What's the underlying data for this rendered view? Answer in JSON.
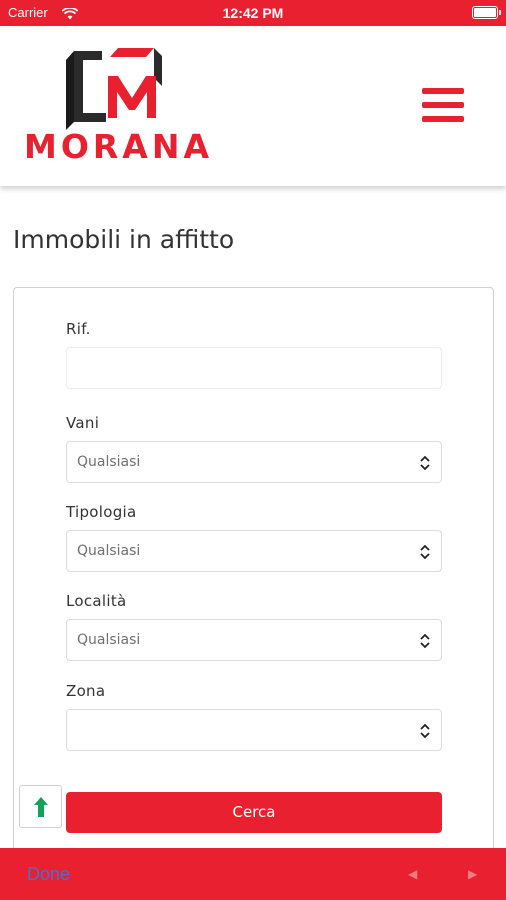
{
  "status_bar": {
    "carrier": "Carrier",
    "time": "12:42 PM"
  },
  "brand": {
    "name": "MORANA",
    "monogram": "CM",
    "colors": {
      "red": "#e8202f",
      "dark": "#2b2b2b"
    }
  },
  "page": {
    "title": "Immobili in affitto"
  },
  "form": {
    "rif": {
      "label": "Rif.",
      "value": "",
      "placeholder": ""
    },
    "vani": {
      "label": "Vani",
      "value": "Qualsiasi"
    },
    "tipologia": {
      "label": "Tipologia",
      "value": "Qualsiasi"
    },
    "localita": {
      "label": "Località",
      "value": "Qualsiasi"
    },
    "zona": {
      "label": "Zona",
      "value": ""
    },
    "submit_label": "Cerca"
  },
  "keyboard_toolbar": {
    "done_label": "Done",
    "prev_icon": "arrow-left-icon",
    "next_icon": "arrow-right-icon"
  },
  "icons": {
    "menu": "hamburger-menu-icon",
    "chevron": "up-down-chevron-icon",
    "scroll_top": "arrow-up-icon",
    "wifi": "wifi-icon",
    "battery": "battery-icon"
  }
}
